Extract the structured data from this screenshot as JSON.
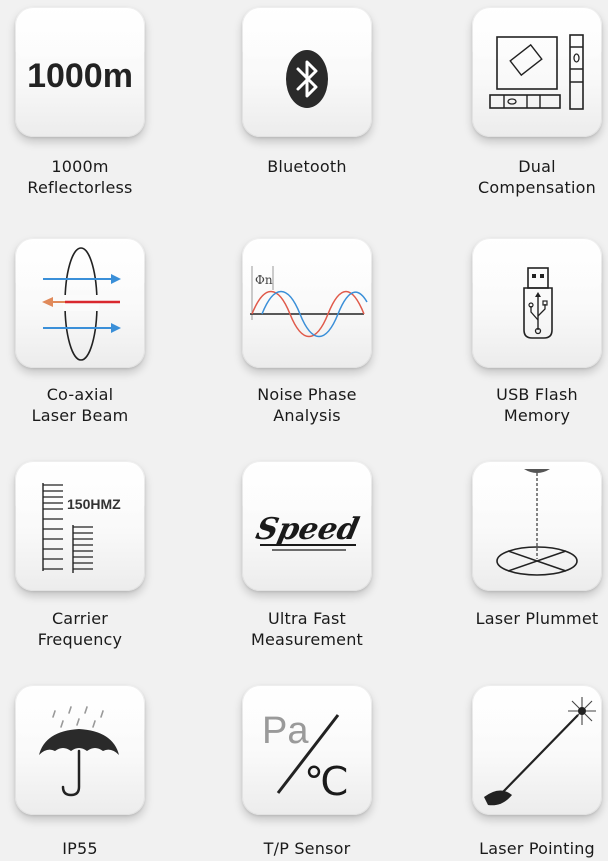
{
  "features": [
    {
      "lines": [
        "1000m",
        "Reflectorless"
      ],
      "icon": "range-1000m-icon",
      "icon_text": "1000m"
    },
    {
      "lines": [
        "Bluetooth"
      ],
      "icon": "bluetooth-icon"
    },
    {
      "lines": [
        "Dual",
        "Compensation"
      ],
      "icon": "dual-compensation-icon"
    },
    {
      "lines": [
        "Co-axial",
        "Laser Beam"
      ],
      "icon": "coaxial-beam-icon"
    },
    {
      "lines": [
        "Noise Phase",
        "Analysis"
      ],
      "icon": "noise-phase-icon",
      "icon_text": "Φn"
    },
    {
      "lines": [
        "USB Flash",
        "Memory"
      ],
      "icon": "usb-flash-icon"
    },
    {
      "lines": [
        "Carrier",
        "Frequency"
      ],
      "icon": "carrier-frequency-icon",
      "icon_text": "150HMZ"
    },
    {
      "lines": [
        "Ultra Fast",
        "Measurement"
      ],
      "icon": "speed-icon",
      "icon_text": "Speed"
    },
    {
      "lines": [
        "Laser Plummet"
      ],
      "icon": "laser-plummet-icon"
    },
    {
      "lines": [
        "IP55"
      ],
      "icon": "umbrella-rain-icon"
    },
    {
      "lines": [
        "T/P Sensor"
      ],
      "icon": "temperature-pressure-icon",
      "icon_text_a": "Pa",
      "icon_text_b": "℃"
    },
    {
      "lines": [
        "Laser Pointing"
      ],
      "icon": "laser-pointing-icon"
    }
  ],
  "colors": {
    "background": "#f1f1f1",
    "icon_dark": "#222222",
    "beam_blue": "#3a8fd8",
    "beam_red": "#d9282e",
    "beam_orange": "#e08a5a"
  }
}
